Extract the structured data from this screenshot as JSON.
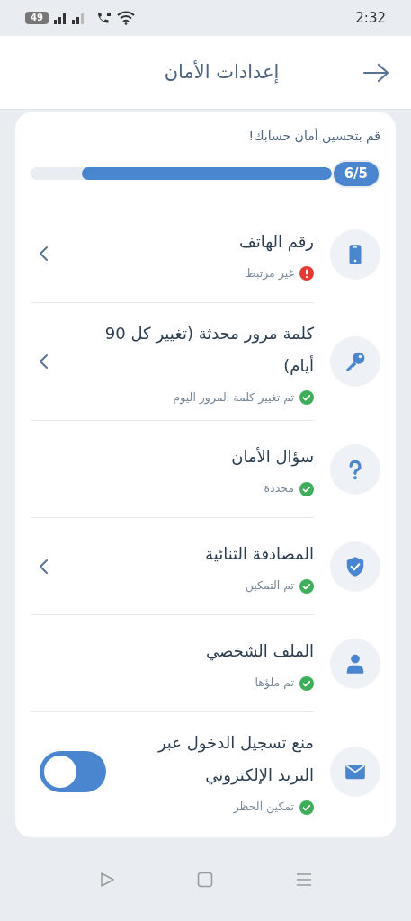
{
  "status_bar": {
    "battery": "49",
    "time": "2:32"
  },
  "header": {
    "title": "إعدادات الأمان"
  },
  "progress": {
    "prompt": "قم بتحسين أمان حسابك!",
    "level": 0.83,
    "count": "6/5"
  },
  "items": [
    {
      "kind": "phone",
      "title": "رقم الهاتف",
      "status": "غير مرتبط",
      "done": false,
      "chevron": true
    },
    {
      "kind": "key",
      "title": "كلمة مرور محدثة (تغيير كل 90 أيام)",
      "status": "تم تغيير كلمة المرور اليوم",
      "done": true,
      "chevron": true
    },
    {
      "kind": "question",
      "title": "سؤال الأمان",
      "status": "محددة",
      "done": true,
      "chevron": false
    },
    {
      "kind": "shield",
      "title": "المصادقة الثنائية",
      "status": "تم التمكين",
      "done": true,
      "chevron": true
    },
    {
      "kind": "user",
      "title": "الملف الشخصي",
      "status": "تم ملؤها",
      "done": true,
      "chevron": false
    },
    {
      "kind": "mail",
      "title": "منع تسجيل الدخول عبر البريد الإلكتروني",
      "status": "تمكين الحظر",
      "done": true,
      "chevron": false,
      "toggle": {
        "on": true
      }
    }
  ]
}
